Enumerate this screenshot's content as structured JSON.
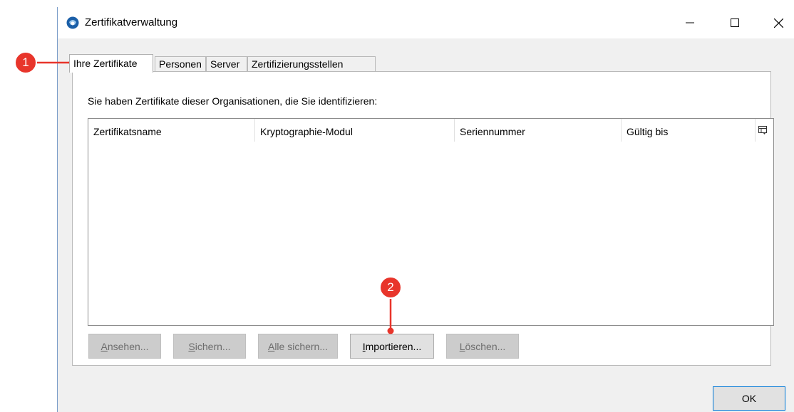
{
  "window": {
    "title": "Zertifikatverwaltung",
    "controls": {
      "minimize": "minimize-icon",
      "maximize": "maximize-icon",
      "close": "close-icon"
    }
  },
  "tabs": [
    {
      "label": "Ihre Zertifikate",
      "active": true
    },
    {
      "label": "Personen",
      "active": false
    },
    {
      "label": "Server",
      "active": false
    },
    {
      "label": "Zertifizierungsstellen",
      "active": false
    }
  ],
  "panel": {
    "label": "Sie haben Zertifikate dieser Organisationen, die Sie identifizieren:",
    "table": {
      "columns": [
        "Zertifikatsname",
        "Kryptographie-Modul",
        "Seriennummer",
        "Gültig bis"
      ],
      "rows": []
    }
  },
  "buttons": {
    "view": {
      "pre": "",
      "accel": "A",
      "post": "nsehen...",
      "enabled": false
    },
    "backup": {
      "pre": "",
      "accel": "S",
      "post": "ichern...",
      "enabled": false
    },
    "backup_all": {
      "pre": "",
      "accel": "A",
      "post": "lle sichern...",
      "enabled": false
    },
    "import": {
      "pre": "",
      "accel": "I",
      "post": "mportieren...",
      "enabled": true
    },
    "delete": {
      "pre": "",
      "accel": "L",
      "post": "öschen...",
      "enabled": false
    },
    "ok": "OK"
  },
  "callouts": [
    {
      "number": "1"
    },
    {
      "number": "2"
    }
  ],
  "colors": {
    "callout": "#e8352b",
    "accent": "#0078d7"
  }
}
